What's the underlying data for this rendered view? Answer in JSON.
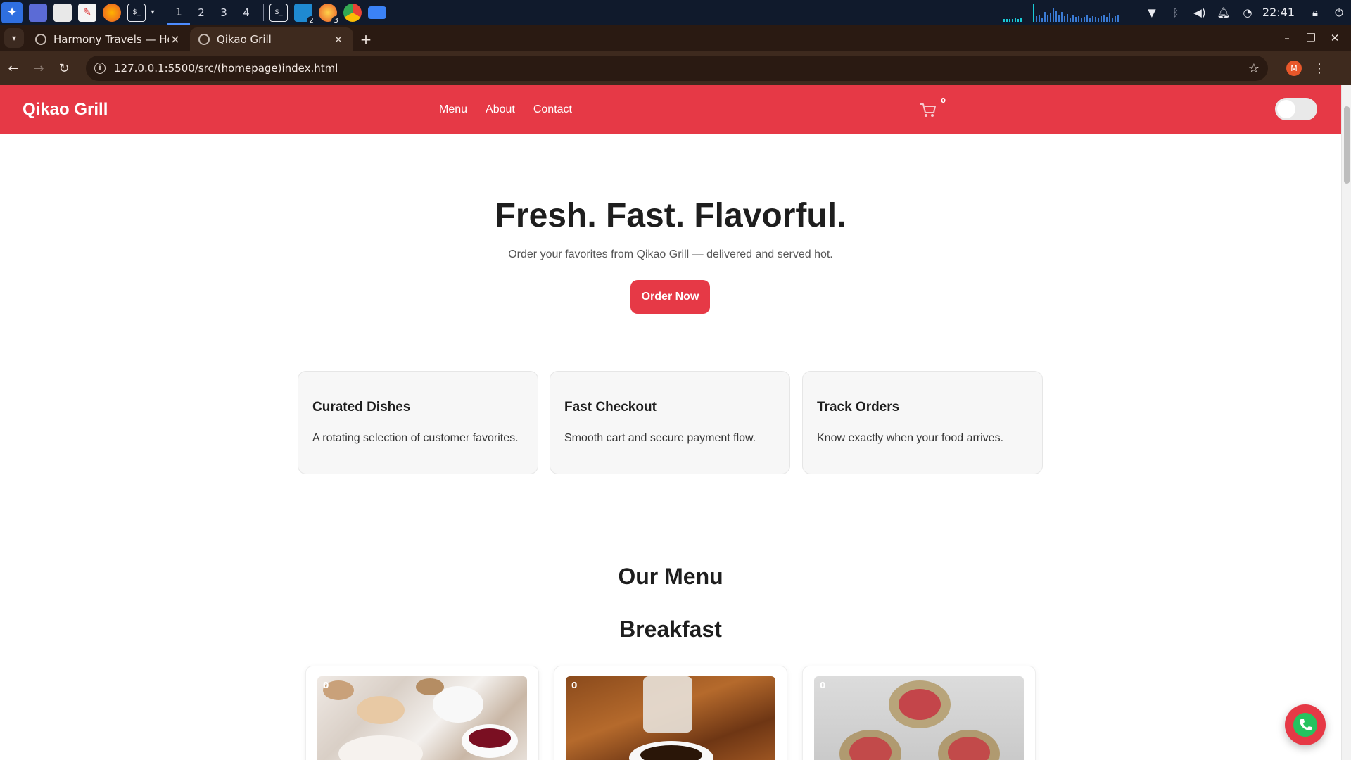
{
  "taskbar": {
    "workspaces": [
      "1",
      "2",
      "3",
      "4"
    ],
    "active_workspace": "1",
    "badges": {
      "vscode": "2",
      "firefox_dev": "3"
    },
    "clock": "22:41"
  },
  "browser": {
    "tabs": [
      {
        "title": "Harmony Travels — Hom",
        "active": false
      },
      {
        "title": "Qikao Grill",
        "active": true
      }
    ],
    "url": "127.0.0.1:5500/src/(homepage)index.html",
    "profile_initial": "M"
  },
  "site": {
    "brand": "Qikao Grill",
    "nav": [
      "Menu",
      "About",
      "Contact"
    ],
    "cart_count": "0",
    "theme_toggle_on": false,
    "hero": {
      "title": "Fresh. Fast. Flavorful.",
      "subtitle": "Order your favorites from Qikao Grill — delivered and served hot.",
      "cta": "Order Now"
    },
    "features": [
      {
        "title": "Curated Dishes",
        "text": "A rotating selection of customer favorites."
      },
      {
        "title": "Fast Checkout",
        "text": "Smooth cart and secure payment flow."
      },
      {
        "title": "Track Orders",
        "text": "Know exactly when your food arrives."
      }
    ],
    "menu_heading": "Our Menu",
    "category": "Breakfast",
    "menu_items": [
      {
        "count": "0"
      },
      {
        "count": "0"
      },
      {
        "count": "0"
      }
    ]
  },
  "colors": {
    "brand_red": "#e63946",
    "taskbar_bg": "#101a2c",
    "browser_frame": "#3e2a1e",
    "whatsapp_green": "#25c35f"
  },
  "icons": {
    "cart": "cart-icon",
    "call": "phone-icon",
    "bookmark": "star-icon",
    "site_info": "info-icon"
  }
}
